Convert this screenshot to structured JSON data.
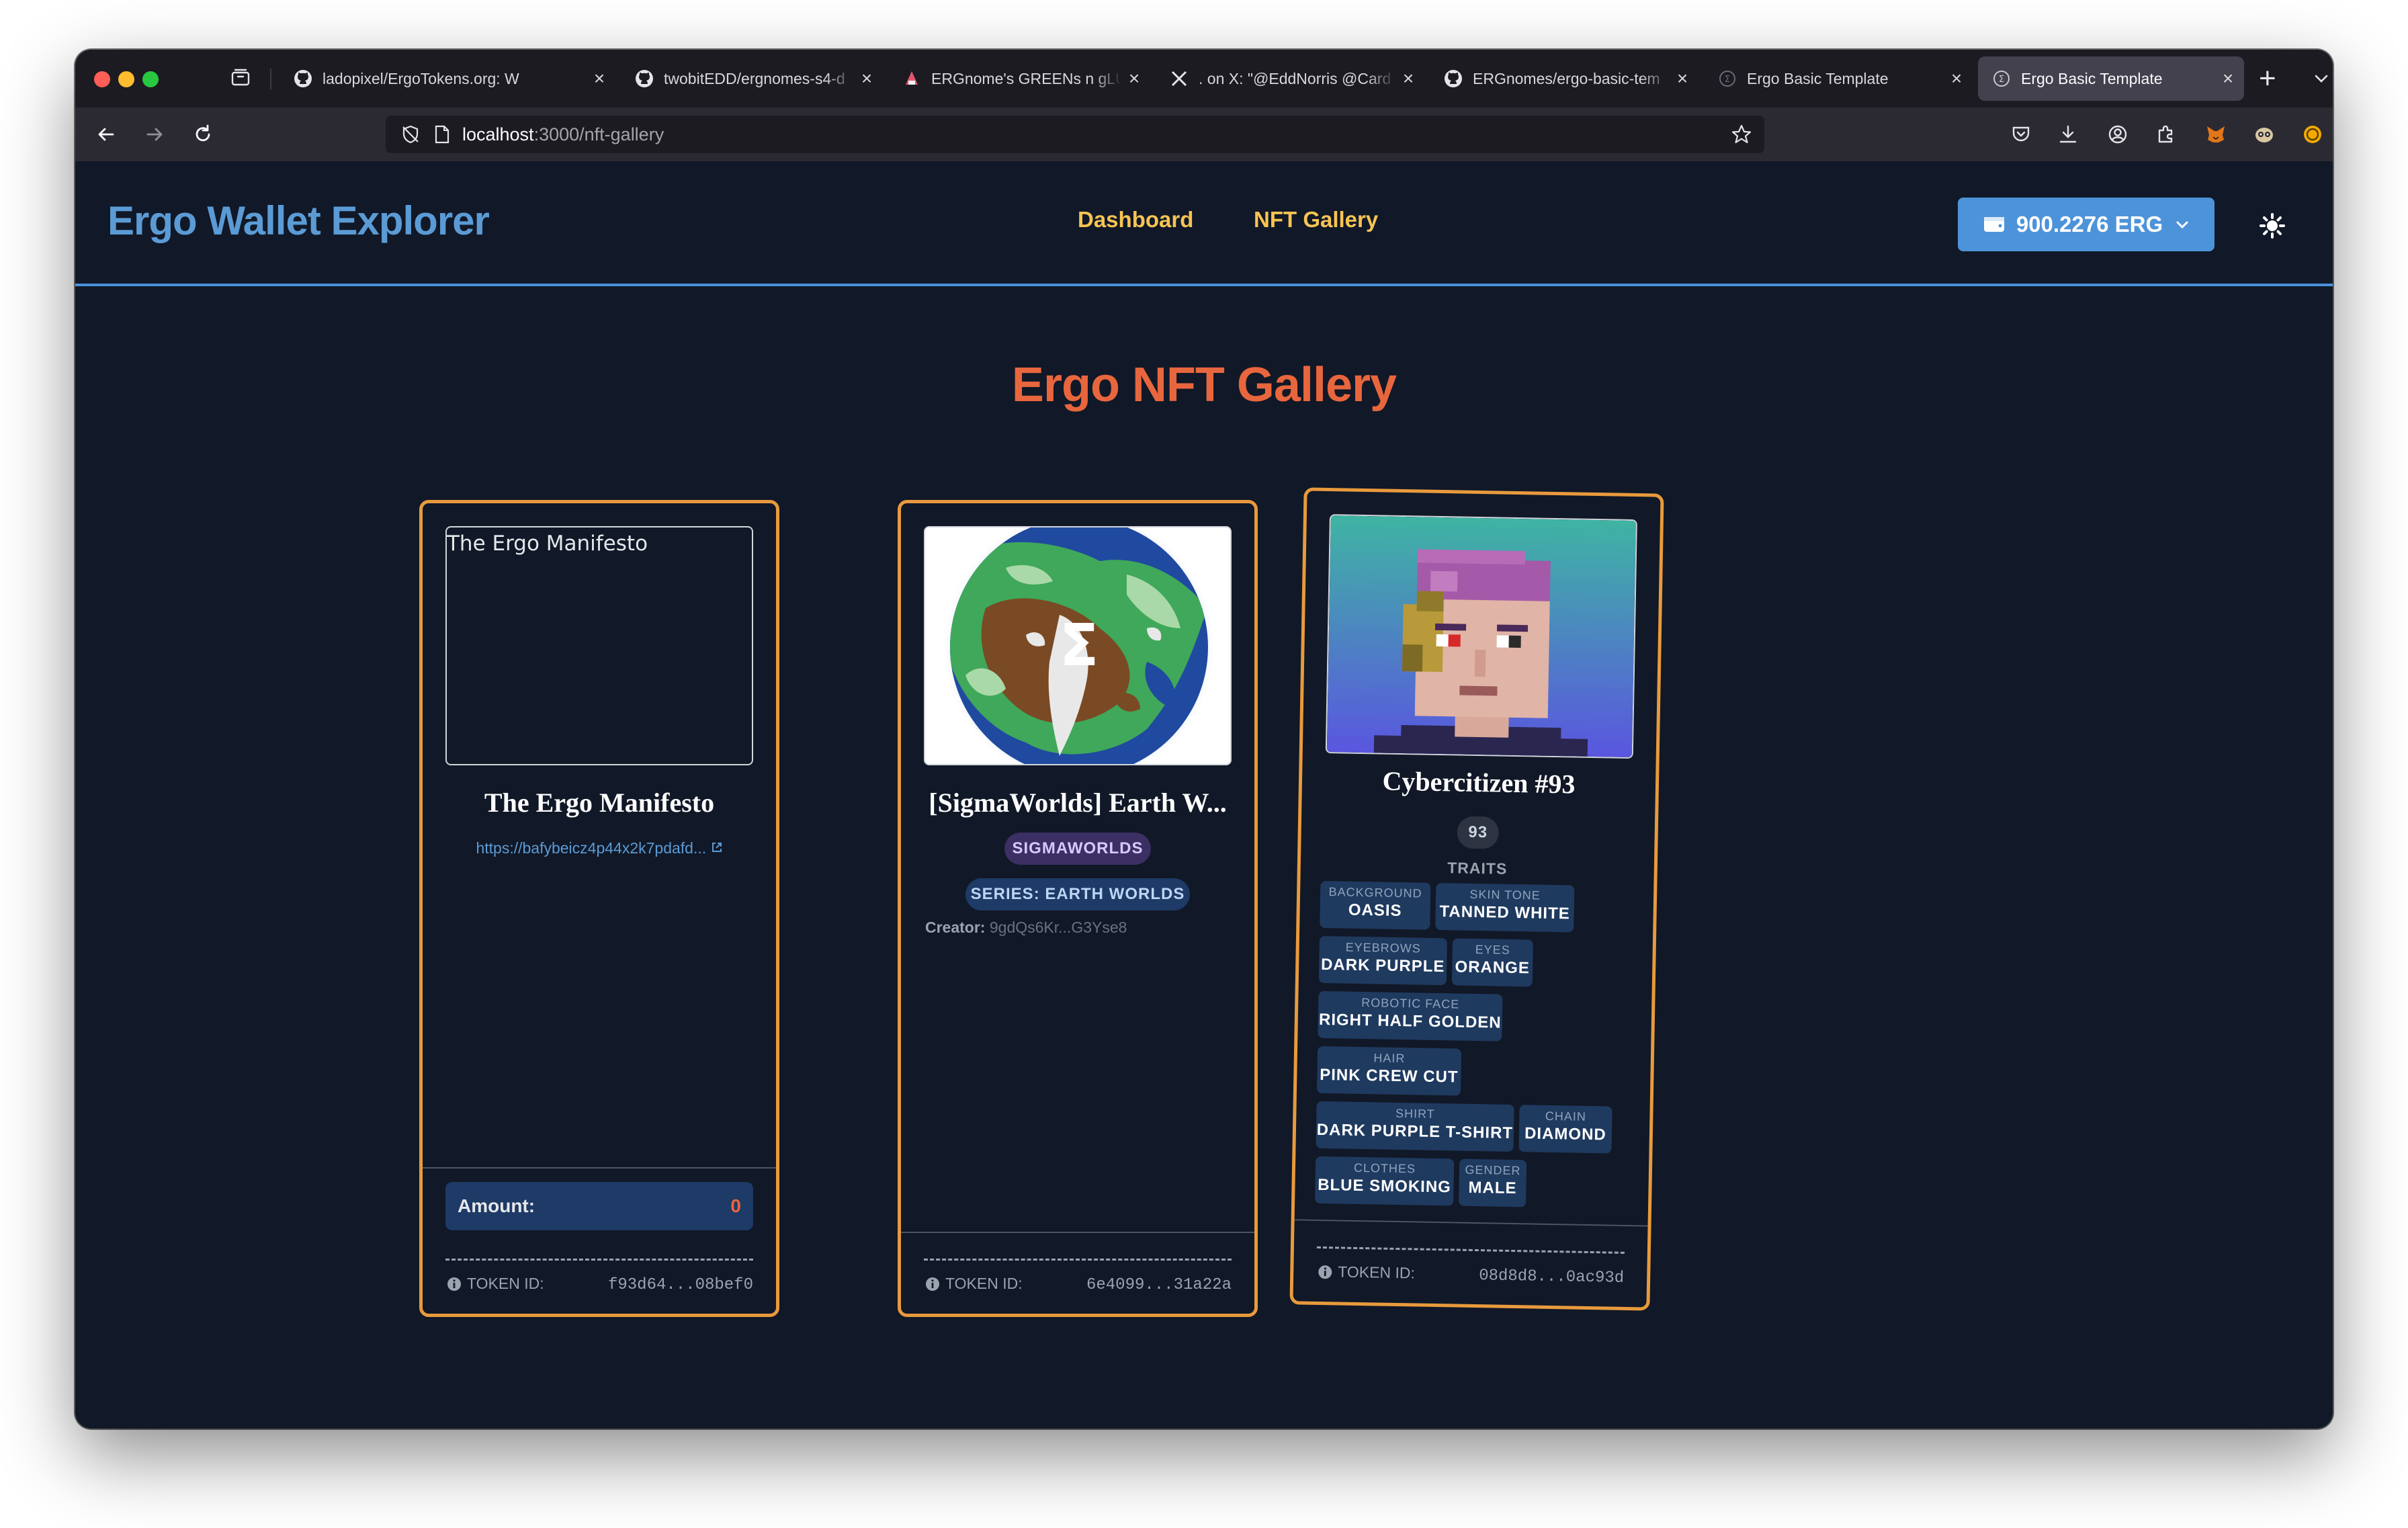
{
  "browser": {
    "tabs": [
      {
        "title": "ladopixel/ErgoTokens.org: W",
        "icon": "github-icon"
      },
      {
        "title": "twobitEDD/ergnomes-s4-d",
        "icon": "github-icon"
      },
      {
        "title": "ERGnome's GREENs n gLUC",
        "icon": "ergnome-icon"
      },
      {
        "title": ". on X: \"@EddNorris @Card",
        "icon": "x-icon"
      },
      {
        "title": "ERGnomes/ergo-basic-tem",
        "icon": "github-icon"
      },
      {
        "title": "Ergo Basic Template",
        "icon": "ergo-icon"
      },
      {
        "title": "Ergo Basic Template",
        "icon": "ergo-icon",
        "active": true
      }
    ],
    "url_host": "localhost",
    "url_path": ":3000/nft-gallery"
  },
  "app": {
    "brand": "Ergo Wallet Explorer",
    "nav": {
      "dashboard": "Dashboard",
      "gallery": "NFT Gallery"
    },
    "wallet_balance": "900.2276 ERG",
    "page_title": "Ergo NFT Gallery"
  },
  "colors": {
    "accent": "#e89a3c",
    "title": "#e8663d",
    "brand": "#5b9bd5",
    "nav": "#f6c453"
  },
  "cards": [
    {
      "image_alt": "The Ergo Manifesto",
      "name": "The Ergo Manifesto",
      "link": "https://bafybeicz4p44x2k7pdafd...",
      "amount_label": "Amount:",
      "amount_value": "0",
      "token_label": "TOKEN ID:",
      "token_id": "f93d64...08bef0"
    },
    {
      "name": "[SigmaWorlds] Earth W...",
      "badge_collection": "SIGMAWORLDS",
      "badge_series": "SERIES: EARTH WORLDS",
      "creator_label": "Creator:",
      "creator_value": "9gdQs6Kr...G3Yse8",
      "token_label": "TOKEN ID:",
      "token_id": "6e4099...31a22a"
    },
    {
      "name": "Cybercitizen #93",
      "number_badge": "93",
      "traits_label": "TRAITS",
      "traits": [
        {
          "key": "BACKGROUND",
          "value": "OASIS"
        },
        {
          "key": "SKIN TONE",
          "value": "TANNED WHITE"
        },
        {
          "key": "EYEBROWS",
          "value": "DARK PURPLE"
        },
        {
          "key": "EYES",
          "value": "ORANGE"
        },
        {
          "key": "ROBOTIC FACE",
          "value": "RIGHT HALF GOLDEN"
        },
        {
          "key": "HAIR",
          "value": "PINK CREW CUT"
        },
        {
          "key": "SHIRT",
          "value": "DARK PURPLE T-SHIRT"
        },
        {
          "key": "CHAIN",
          "value": "DIAMOND"
        },
        {
          "key": "CLOTHES",
          "value": "BLUE SMOKING"
        },
        {
          "key": "GENDER",
          "value": "MALE"
        }
      ],
      "token_label": "TOKEN ID:",
      "token_id": "08d8d8...0ac93d"
    }
  ]
}
